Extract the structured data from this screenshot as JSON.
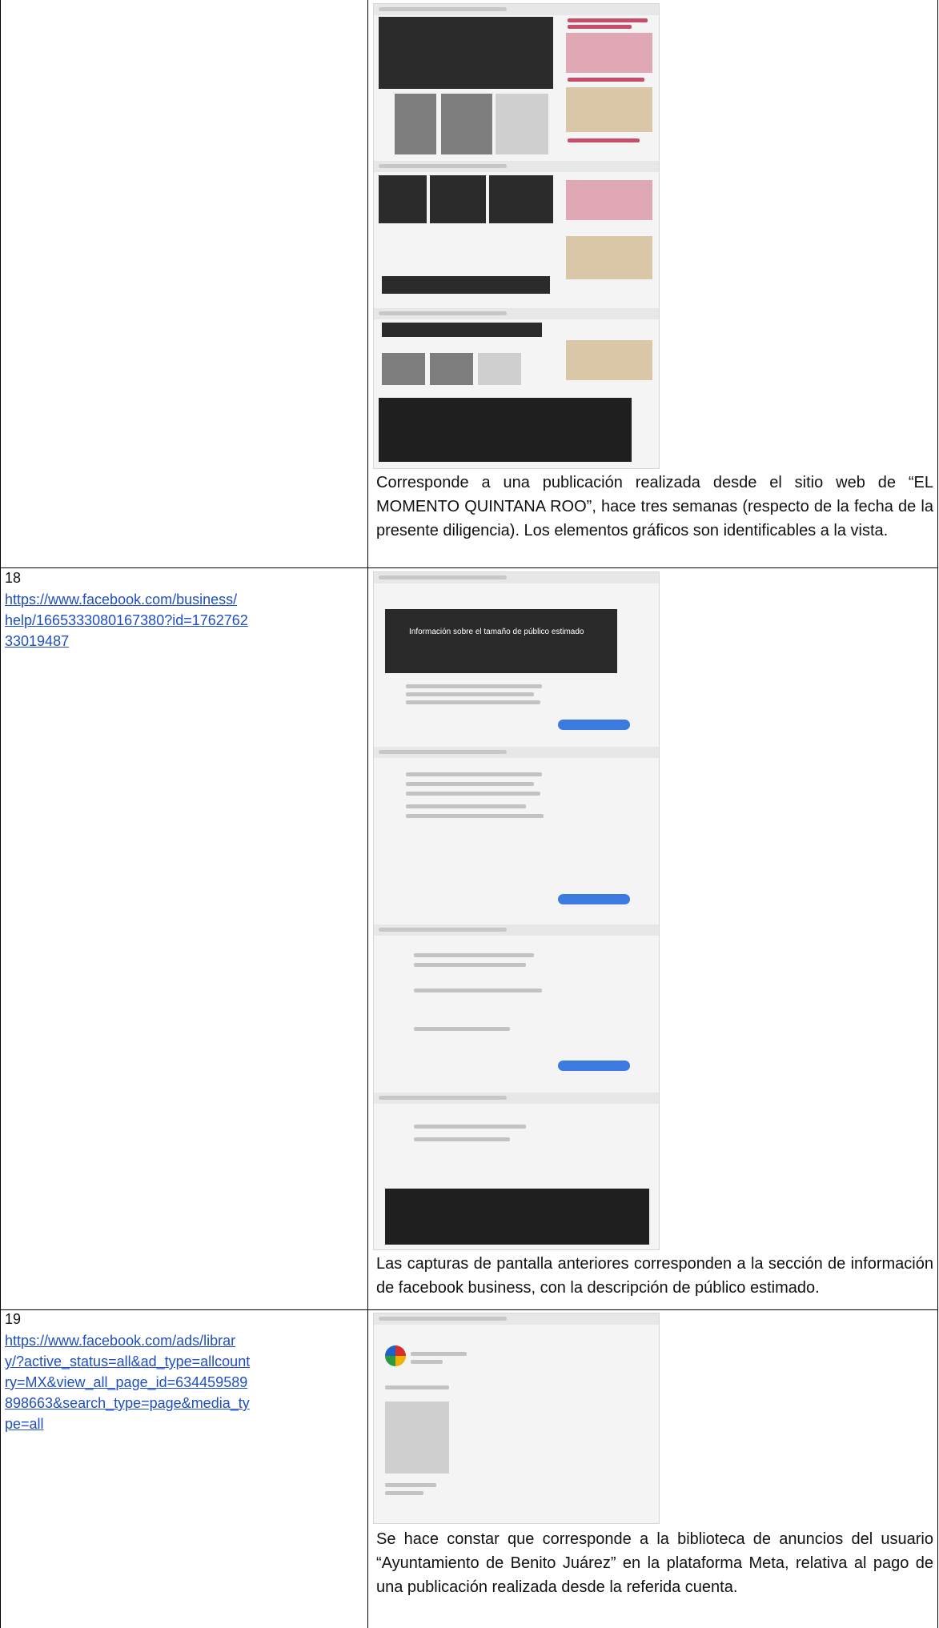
{
  "rows": [
    {
      "number": "",
      "url": "",
      "description": "Corresponde a una publicación realizada desde el sitio web de “EL MOMENTO QUINTANA ROO”, hace tres semanas (respecto de la fecha de la presente diligencia). Los elementos gráficos son identificables a la vista."
    },
    {
      "number": "18",
      "url": "https://www.facebook.com/business/help/1665333080167380?id=176276233019487",
      "url_display": "https://www.facebook.com/business/\nhelp/1665333080167380?id=1762762\n33019487",
      "banner_title": "Información sobre el tamaño de público estimado",
      "description": "Las capturas de pantalla anteriores corresponden a la sección de información de facebook business, con la descripción de público estimado."
    },
    {
      "number": "19",
      "url": "https://www.facebook.com/ads/library/?active_status=all&ad_type=allcountry=MX&view_all_page_id=634459589898663&search_type=page&media_type=all",
      "url_display": "https://www.facebook.com/ads/librar\ny/?active_status=all&ad_type=allcount\nry=MX&view_all_page_id=634459589\n898663&search_type=page&media_ty\npe=all",
      "description": "Se hace constar que corresponde a la biblioteca de anuncios del usuario “Ayuntamiento de Benito Juárez” en la plataforma Meta, relativa al pago de una publicación realizada desde la referida cuenta."
    }
  ],
  "screenshots": {
    "row17": "news-site-captures",
    "row18": "facebook-business-help-captures",
    "row19": "meta-ad-library-capture"
  },
  "colors": {
    "link": "#1f4fc4",
    "accent_red": "#c94d6b",
    "button_blue": "#3b7be0"
  }
}
